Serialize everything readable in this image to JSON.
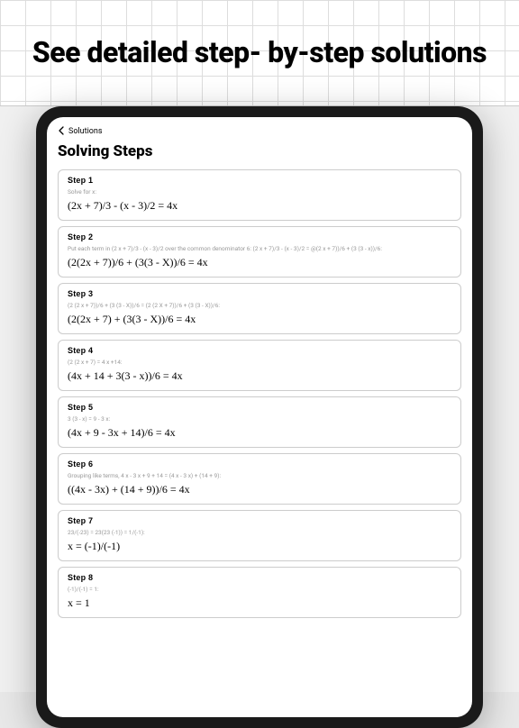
{
  "hero": {
    "title": "See detailed step- by-step solutions"
  },
  "nav": {
    "back_label": "Solutions"
  },
  "page": {
    "title": "Solving Steps"
  },
  "steps": [
    {
      "label": "Step 1",
      "hint": "Solve for x:",
      "expr": "(2x + 7)/3 - (x - 3)/2 = 4x"
    },
    {
      "label": "Step 2",
      "hint": "Put each term in (2 x + 7)/3 - (x - 3)/2 over the common denominator 6: (2 x + 7)/3 - (x - 3)/2 = @(2 x + 7))/6 + (3 (3 - x))/6:",
      "expr": "(2(2x + 7))/6 + (3(3 - X))/6 = 4x"
    },
    {
      "label": "Step 3",
      "hint": "(2 (2 x + 7))/6 + (3 (3 - X))/6 = (2 (2 X + 7))/6 + (3 (3 - X))/6:",
      "expr": "(2(2x + 7) + (3(3 - X))/6 = 4x"
    },
    {
      "label": "Step 4",
      "hint": "(2 (2 x + 7) = 4 x +14:",
      "expr": "(4x + 14 + 3(3 - x))/6 = 4x"
    },
    {
      "label": "Step 5",
      "hint": "3 (3 - x) = 9 - 3 x:",
      "expr": "(4x + 9 - 3x + 14)/6 = 4x"
    },
    {
      "label": "Step 6",
      "hint": "Grouping like terms, 4 x - 3 x + 9 + 14 = (4 x - 3 x) + (14 + 9):",
      "expr": "((4x - 3x) + (14 + 9))/6 = 4x"
    },
    {
      "label": "Step 7",
      "hint": "23/(-23) = 23(23 (-1)) = 1/(-1):",
      "expr": "x = (-1)/(-1)"
    },
    {
      "label": "Step 8",
      "hint": "(-1)/(-1) = 1:",
      "expr": "x = 1"
    }
  ]
}
